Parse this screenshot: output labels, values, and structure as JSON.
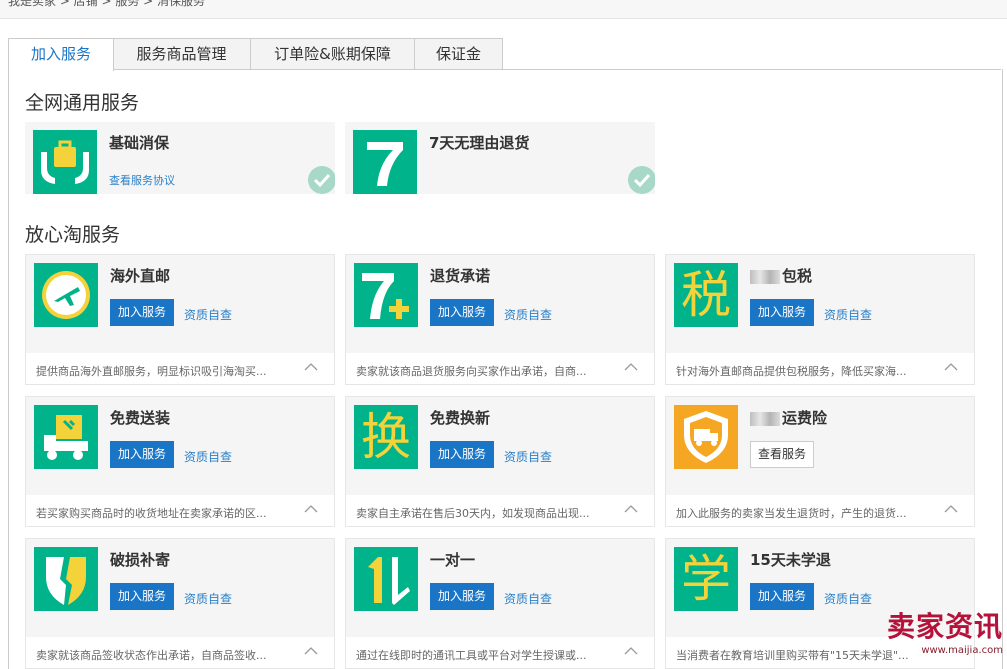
{
  "breadcrumb": "我是卖家 > 店铺 > 服务 > 消保服务",
  "tabs": [
    "加入服务",
    "服务商品管理",
    "订单险&账期保障",
    "保证金"
  ],
  "sections": {
    "general": "全网通用服务",
    "trusted": "放心淘服务"
  },
  "general_cards": [
    {
      "title": "基础消保",
      "link": "查看服务协议"
    },
    {
      "title": "7天无理由退货"
    }
  ],
  "service_cards": [
    {
      "title": "海外直邮",
      "button": "加入服务",
      "qualify": "资质自查",
      "desc": "提供商品海外直邮服务，明显标识吸引海淘买..."
    },
    {
      "title": "退货承诺",
      "button": "加入服务",
      "qualify": "资质自查",
      "desc": "卖家就该商品退货服务向买家作出承诺，自商..."
    },
    {
      "title": "包税",
      "button": "加入服务",
      "qualify": "资质自查",
      "desc": "针对海外直邮商品提供包税服务，降低买家海..."
    },
    {
      "title": "免费送装",
      "button": "加入服务",
      "qualify": "资质自查",
      "desc": "若买家购买商品时的收货地址在卖家承诺的区..."
    },
    {
      "title": "免费换新",
      "button": "加入服务",
      "qualify": "资质自查",
      "desc": "卖家自主承诺在售后30天内，如发现商品出现..."
    },
    {
      "title": "运费险",
      "button": "查看服务",
      "desc": "加入此服务的卖家当发生退货时，产生的退货..."
    },
    {
      "title": "破损补寄",
      "button": "加入服务",
      "qualify": "资质自查",
      "desc": "卖家就该商品签收状态作出承诺，自商品签收..."
    },
    {
      "title": "一对一",
      "button": "加入服务",
      "qualify": "资质自查",
      "desc": "通过在线即时的通讯工具或平台对学生授课或..."
    },
    {
      "title": "15天未学退",
      "button": "加入服务",
      "qualify": "资质自查",
      "desc": "当消费者在教育培训里购买带有\"15天未学退\"..."
    }
  ],
  "icons": {
    "tax_char": "税",
    "exchange_char": "换",
    "learn_char": "学"
  },
  "watermark": {
    "main": "卖家资讯",
    "sub": "www.maijia.com"
  },
  "colors": {
    "accent": "#1a75c7",
    "icon_green": "#00b38a",
    "icon_orange": "#f5a623",
    "check": "#a8d9c8"
  }
}
